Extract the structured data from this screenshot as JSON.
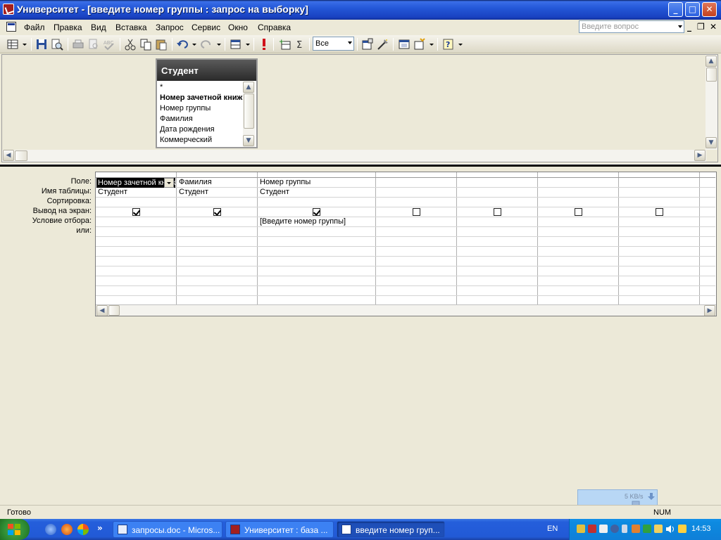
{
  "window": {
    "title": "Университет - [введите номер группы : запрос на выборку]"
  },
  "menu": {
    "items": [
      "Файл",
      "Правка",
      "Вид",
      "Вставка",
      "Запрос",
      "Сервис",
      "Окно",
      "Справка"
    ],
    "ask_placeholder": "Введите вопрос"
  },
  "toolbar": {
    "top_values_combo": "Все",
    "icons": [
      "view-icon",
      "save-icon",
      "print-preview-icon",
      "print-icon",
      "spelling-icon",
      "cut-icon",
      "copy-icon",
      "paste-icon",
      "undo-icon",
      "redo-icon",
      "query-type-icon",
      "run-icon",
      "show-table-icon",
      "totals-icon",
      "properties-icon",
      "build-icon",
      "database-window-icon",
      "new-object-icon",
      "help-icon"
    ]
  },
  "table_box": {
    "title": "Студент",
    "fields": [
      "*",
      "Номер зачетной книжки",
      "Номер группы",
      "Фамилия",
      "Дата рождения",
      "Коммерческий"
    ]
  },
  "grid": {
    "row_labels": [
      "Поле:",
      "Имя таблицы:",
      "Сортировка:",
      "Вывод на экран:",
      "Условие отбора:",
      "или:"
    ],
    "columns": [
      {
        "field": "Номер зачетной книжки",
        "table": "Студент",
        "sort": "",
        "show": true,
        "criteria": ""
      },
      {
        "field": "Фамилия",
        "table": "Студент",
        "sort": "",
        "show": true,
        "criteria": ""
      },
      {
        "field": "Номер группы",
        "table": "Студент",
        "sort": "",
        "show": true,
        "criteria": "[Введите номер группы]"
      },
      {
        "field": "",
        "table": "",
        "sort": "",
        "show": false,
        "criteria": ""
      },
      {
        "field": "",
        "table": "",
        "sort": "",
        "show": false,
        "criteria": ""
      },
      {
        "field": "",
        "table": "",
        "sort": "",
        "show": false,
        "criteria": ""
      },
      {
        "field": "",
        "table": "",
        "sort": "",
        "show": false,
        "criteria": ""
      }
    ]
  },
  "status": {
    "text": "Готово",
    "num": "NUM",
    "net_speed": "5 KB/s"
  },
  "taskbar": {
    "buttons": [
      "запросы.doc - Micros...",
      "Университет : база ...",
      "введите номер груп..."
    ],
    "active_index": 2,
    "overflow": "»",
    "language": "EN",
    "clock": "14:53"
  }
}
